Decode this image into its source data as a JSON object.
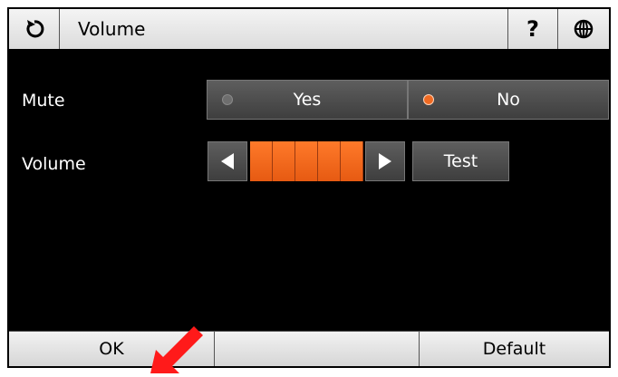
{
  "header": {
    "title": "Volume",
    "back_icon": "refresh-icon",
    "help_label": "?",
    "language_icon": "globe-icon"
  },
  "mute": {
    "label": "Mute",
    "options": [
      {
        "label": "Yes",
        "selected": false
      },
      {
        "label": "No",
        "selected": true
      }
    ]
  },
  "volume": {
    "label": "Volume",
    "level": 5,
    "max_level": 5,
    "decrease_icon": "triangle-left-icon",
    "increase_icon": "triangle-right-icon",
    "test_label": "Test"
  },
  "footer": {
    "ok_label": "OK",
    "middle_label": "",
    "default_label": "Default"
  },
  "colors": {
    "accent": "#f06a22",
    "annotation": "#ff1a1a"
  }
}
